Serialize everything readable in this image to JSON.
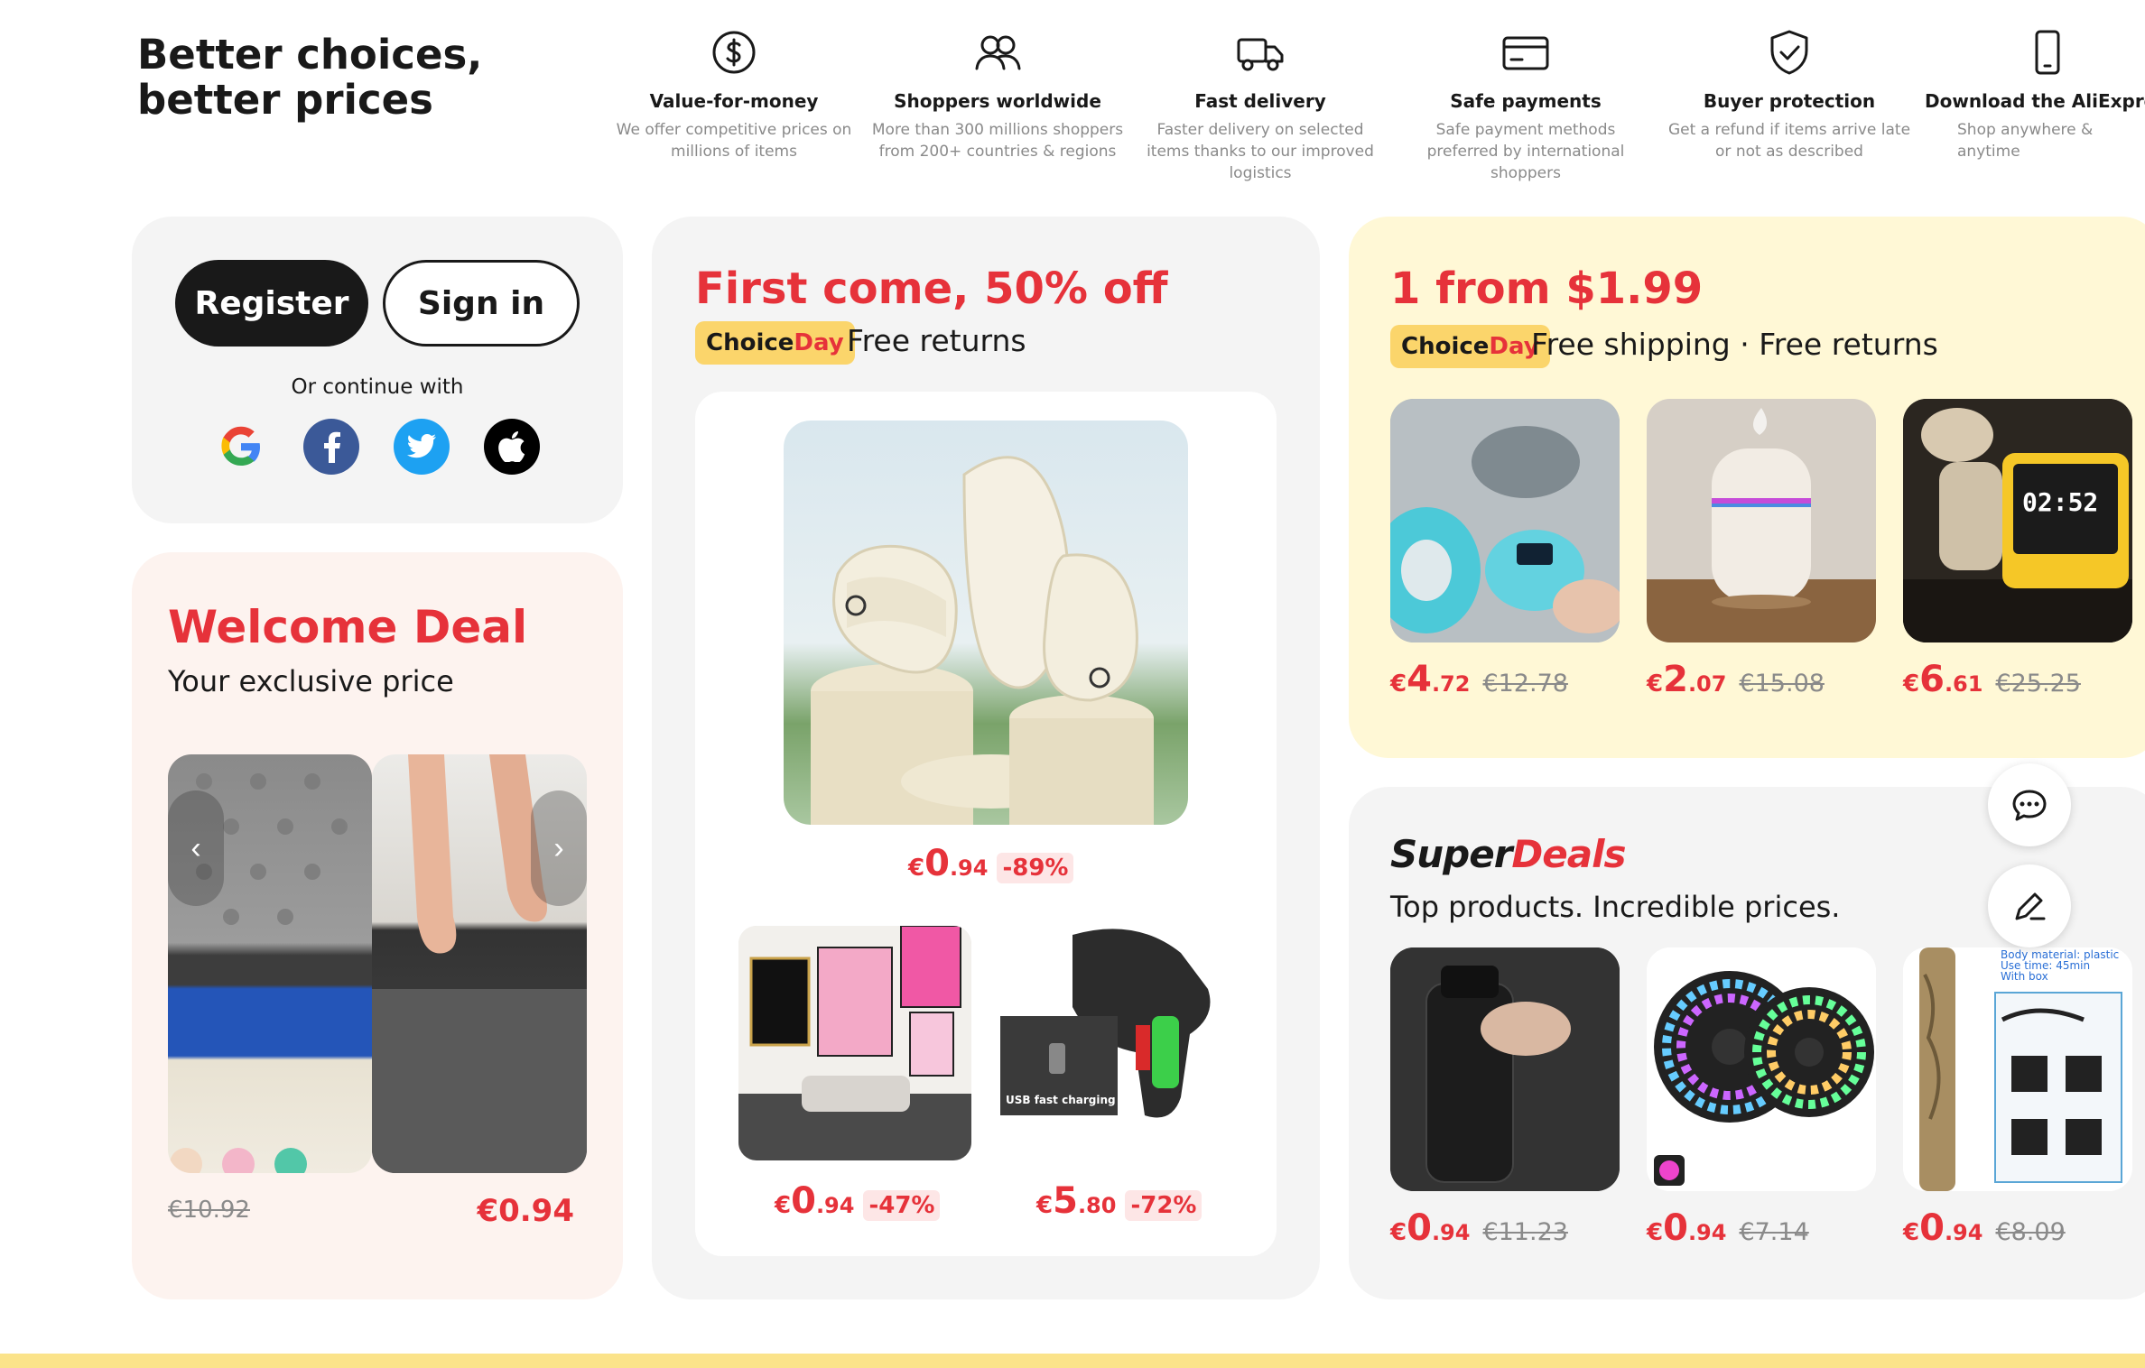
{
  "tagline": {
    "line1": "Better choices,",
    "line2": "better prices"
  },
  "benefits": [
    {
      "icon": "dollar-circle-icon",
      "title": "Value-for-money",
      "desc": "We offer competitive prices on millions of items"
    },
    {
      "icon": "users-icon",
      "title": "Shoppers worldwide",
      "desc": "More than 300 millions shoppers from 200+ countries & regions"
    },
    {
      "icon": "truck-icon",
      "title": "Fast delivery",
      "desc": "Faster delivery on selected items thanks to our improved logistics"
    },
    {
      "icon": "credit-card-icon",
      "title": "Safe payments",
      "desc": "Safe payment methods preferred by international shoppers"
    },
    {
      "icon": "shield-check-icon",
      "title": "Buyer protection",
      "desc": "Get a refund if items arrive late or not as described"
    },
    {
      "icon": "phone-icon",
      "title": "Download the AliExpress app",
      "desc": "Shop anywhere & anytime"
    }
  ],
  "login": {
    "register_label": "Register",
    "signin_label": "Sign in",
    "or_continue": "Or continue with",
    "socials": [
      "google-icon",
      "facebook-icon",
      "twitter-icon",
      "apple-icon"
    ]
  },
  "welcome": {
    "title": "Welcome Deal",
    "subtitle": "Your exclusive price",
    "old_price": "€10.92",
    "new_price": "€0.94"
  },
  "first_come": {
    "title": "First come, 50% off",
    "badge_choice": "Choice",
    "badge_day": "Day",
    "note": "Free returns",
    "main_product": {
      "currency": "€",
      "int": "0",
      "dec": ".94",
      "discount": "-89%"
    },
    "products": [
      {
        "currency": "€",
        "int": "0",
        "dec": ".94",
        "discount": "-47%"
      },
      {
        "currency": "€",
        "int": "5",
        "dec": ".80",
        "discount": "-72%",
        "image_caption": "USB fast charging"
      }
    ]
  },
  "dollar_deals": {
    "title": "1 from $1.99",
    "badge_choice": "Choice",
    "badge_day": "Day",
    "note": "Free shipping · Free returns",
    "products": [
      {
        "currency": "€",
        "int": "4",
        "dec": ".72",
        "old": "€12.78"
      },
      {
        "currency": "€",
        "int": "2",
        "dec": ".07",
        "old": "€15.08"
      },
      {
        "currency": "€",
        "int": "6",
        "dec": ".61",
        "old": "€25.25"
      }
    ],
    "clock_time": "02:52"
  },
  "super_deals": {
    "logo_super": "Super",
    "logo_deals": "Deals",
    "subtitle": "Top products. Incredible prices.",
    "products": [
      {
        "currency": "€",
        "int": "0",
        "dec": ".94",
        "old": "€11.23"
      },
      {
        "currency": "€",
        "int": "0",
        "dec": ".94",
        "old": "€7.14"
      },
      {
        "currency": "€",
        "int": "0",
        "dec": ".94",
        "old": "€8.09"
      }
    ],
    "spec_lines": [
      "Body material: plastic",
      "Use time: 45min",
      "With box"
    ]
  },
  "floating": [
    "chat-icon",
    "edit-icon"
  ],
  "colors": {
    "accent": "#e6323a",
    "choice_yellow": "#fbd56b",
    "dollar_bg": "#fff8d6",
    "welcome_bg": "#fdf3ef",
    "card_gray": "#f4f4f4"
  }
}
